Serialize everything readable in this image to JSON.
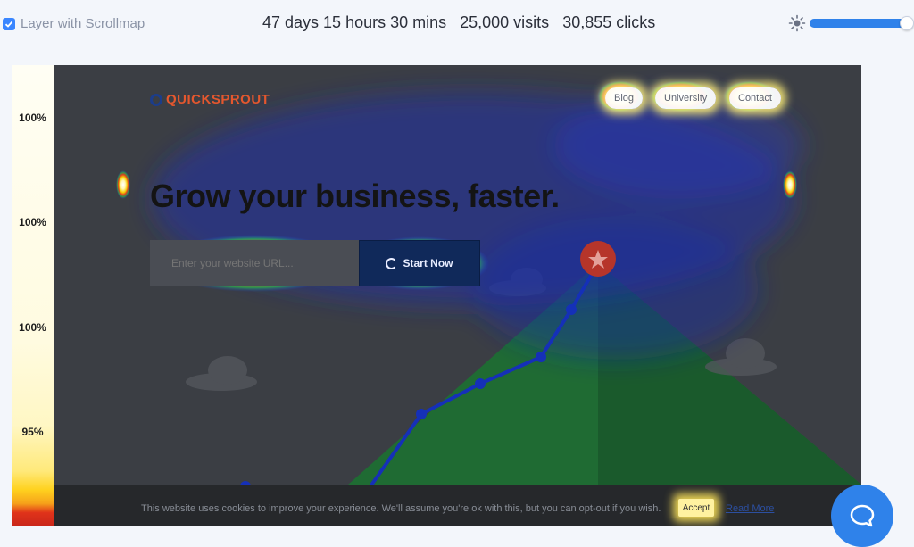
{
  "toolbar": {
    "layer_label": "Layer with Scrollmap",
    "layer_checked": true,
    "duration": "47 days 15 hours 30 mins",
    "visits": "25,000 visits",
    "clicks": "30,855 clicks",
    "brightness_icon": "sun-icon",
    "brightness_level": 0.97,
    "accent_color": "#2f82ea"
  },
  "scrollmap": {
    "labels": [
      "100%",
      "100%",
      "100%",
      "95%"
    ]
  },
  "site": {
    "logo_text": "QUICKSPROUT",
    "nav": [
      "Blog",
      "University",
      "Contact"
    ],
    "headline": "Grow your business, faster.",
    "url_placeholder": "Enter your website URL...",
    "start_button": "Start Now",
    "cookie_text": "This website uses cookies to improve your experience. We'll assume you're ok with this, but you can opt-out if you wish.",
    "accept_button": "Accept",
    "read_more": "Read More"
  },
  "chat": {
    "icon": "chat-bubble-icon"
  }
}
